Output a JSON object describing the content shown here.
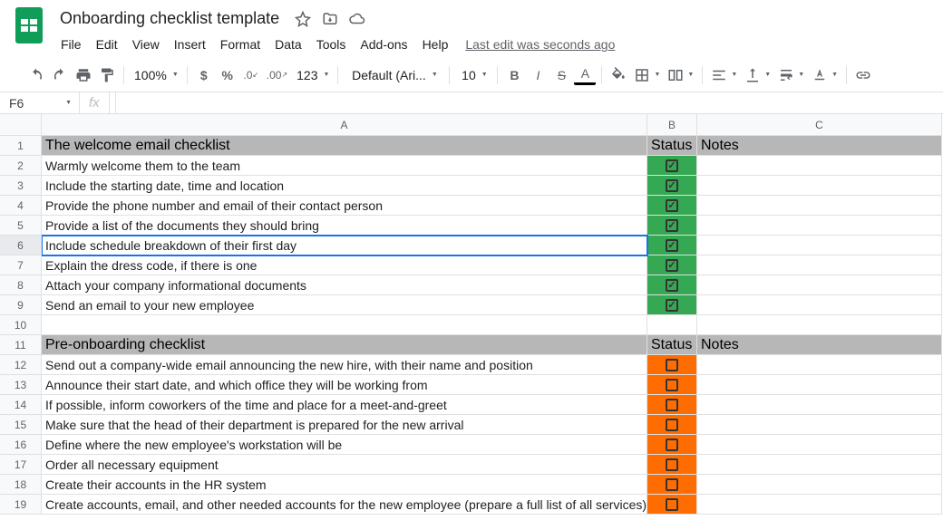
{
  "doc": {
    "title": "Onboarding checklist template",
    "last_edit": "Last edit was seconds ago"
  },
  "menu": [
    "File",
    "Edit",
    "View",
    "Insert",
    "Format",
    "Data",
    "Tools",
    "Add-ons",
    "Help"
  ],
  "toolbar": {
    "zoom": "100%",
    "format": "Default (Ari...",
    "fontsize": "10",
    "decimal_less": ".0",
    "decimal_more": ".00",
    "numfmt": "123"
  },
  "namebox": "F6",
  "fx_placeholder": "fx",
  "columns": [
    "A",
    "B",
    "C"
  ],
  "sections": [
    {
      "row": 1,
      "title": "The welcome email checklist",
      "status_label": "Status",
      "notes_label": "Notes",
      "items": [
        {
          "row": 2,
          "text": "Warmly welcome them to the team",
          "checked": true
        },
        {
          "row": 3,
          "text": "Include the starting date, time and location",
          "checked": true
        },
        {
          "row": 4,
          "text": "Provide the phone number and email of their contact person",
          "checked": true
        },
        {
          "row": 5,
          "text": "Provide a list of the documents they should bring",
          "checked": true
        },
        {
          "row": 6,
          "text": "Include schedule breakdown of their first day",
          "checked": true
        },
        {
          "row": 7,
          "text": "Explain the dress code, if there is one",
          "checked": true
        },
        {
          "row": 8,
          "text": "Attach your company informational documents",
          "checked": true
        },
        {
          "row": 9,
          "text": "Send an email to your new employee",
          "checked": true
        }
      ]
    },
    {
      "row": 11,
      "title": "Pre-onboarding checklist",
      "status_label": "Status",
      "notes_label": "Notes",
      "items": [
        {
          "row": 12,
          "text": "Send out a company-wide email announcing the new hire, with their name and position",
          "checked": false
        },
        {
          "row": 13,
          "text": "Announce their start date, and which office they will be working from",
          "checked": false
        },
        {
          "row": 14,
          "text": "If possible, inform coworkers of the time and place for a meet-and-greet",
          "checked": false
        },
        {
          "row": 15,
          "text": "Make sure that the head of their department is prepared for the new arrival",
          "checked": false
        },
        {
          "row": 16,
          "text": "Define where the new employee's workstation will be",
          "checked": false
        },
        {
          "row": 17,
          "text": "Order all necessary equipment",
          "checked": false
        },
        {
          "row": 18,
          "text": "Create their accounts in the HR system",
          "checked": false
        },
        {
          "row": 19,
          "text": "Create accounts, email, and other needed accounts for the new employee (prepare a full list of all services)",
          "checked": false
        }
      ]
    }
  ],
  "blank_rows": [
    10
  ],
  "selected_row": 6
}
